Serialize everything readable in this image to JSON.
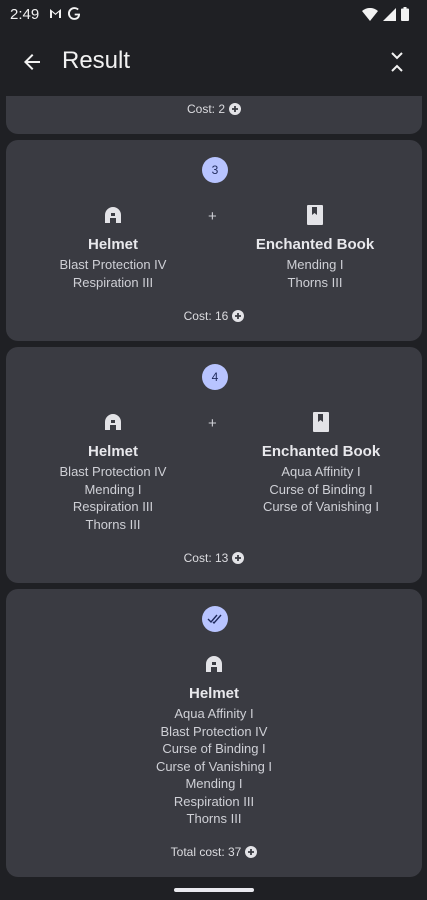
{
  "status": {
    "time": "2:49"
  },
  "appbar": {
    "title": "Result"
  },
  "top_card": {
    "cost": "Cost: 2"
  },
  "steps": [
    {
      "badge": "3",
      "left": {
        "name": "Helmet",
        "enchants": [
          "Blast Protection IV",
          "Respiration III"
        ]
      },
      "plus": "+",
      "right": {
        "name": "Enchanted Book",
        "enchants": [
          "Mending I",
          "Thorns III"
        ]
      },
      "cost": "Cost: 16"
    },
    {
      "badge": "4",
      "left": {
        "name": "Helmet",
        "enchants": [
          "Blast Protection IV",
          "Mending I",
          "Respiration III",
          "Thorns III"
        ]
      },
      "plus": "+",
      "right": {
        "name": "Enchanted Book",
        "enchants": [
          "Aqua Affinity I",
          "Curse of Binding I",
          "Curse of Vanishing I"
        ]
      },
      "cost": "Cost: 13"
    }
  ],
  "final": {
    "name": "Helmet",
    "enchants": [
      "Aqua Affinity I",
      "Blast Protection IV",
      "Curse of Binding I",
      "Curse of Vanishing I",
      "Mending I",
      "Respiration III",
      "Thorns III"
    ],
    "total_cost": "Total cost: 37"
  },
  "colors": {
    "background": "#1f2024",
    "card": "#3a3b42",
    "badge": "#b8c4ff"
  },
  "icons": [
    "gmail-icon",
    "google-icon",
    "wifi-icon",
    "signal-icon",
    "battery-icon",
    "back-arrow-icon",
    "collapse-icon",
    "helmet-icon",
    "book-icon",
    "coin-icon",
    "double-check-icon"
  ]
}
